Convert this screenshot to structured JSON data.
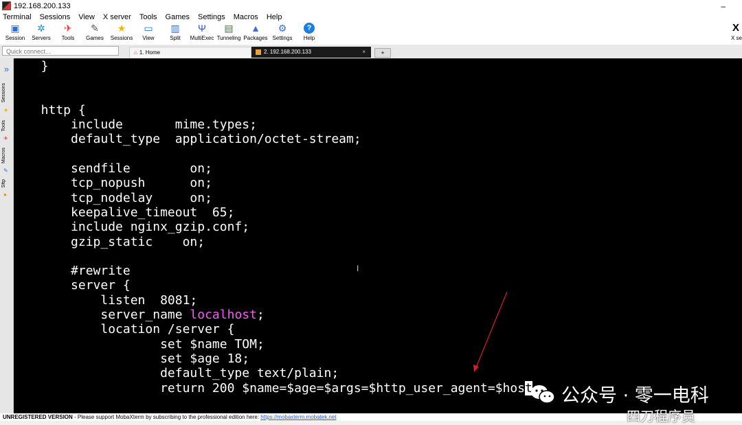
{
  "window": {
    "title": "192.168.200.133",
    "minimize_glyph": "–"
  },
  "menu": [
    "Terminal",
    "Sessions",
    "View",
    "X server",
    "Tools",
    "Games",
    "Settings",
    "Macros",
    "Help"
  ],
  "toolbar": {
    "session": "Session",
    "servers": "Servers",
    "tools": "Tools",
    "games": "Games",
    "sessions": "Sessions",
    "view": "View",
    "split": "Split",
    "multiexec": "MultiExec",
    "tunneling": "Tunneling",
    "packages": "Packages",
    "settings": "Settings",
    "help": "Help",
    "xserver": "X server"
  },
  "quick_connect": {
    "placeholder": "Quick connect..."
  },
  "tabs": {
    "home": "1. Home",
    "ssh": "2. 192.168.200.133",
    "close": "×",
    "new": "+"
  },
  "sidebar": {
    "sessions": "Sessions",
    "tools": "Tools",
    "macros": "Macros",
    "sftp": "Sftp"
  },
  "terminal": {
    "lines": [
      "  }",
      "",
      "",
      "  http {",
      "      include       mime.types;",
      "      default_type  application/octet-stream;",
      "",
      "      sendfile        on;",
      "      tcp_nopush      on;",
      "      tcp_nodelay     on;",
      "      keepalive_timeout  65;",
      "      include nginx_gzip.conf;",
      "      gzip_static    on;",
      "",
      "      #rewrite",
      "      server {",
      "          listen  8081;",
      "          server_name "
    ],
    "server_name_value": "localhost",
    "server_name_tail": ";",
    "lines_after": [
      "          location /server {",
      "                  set $name TOM;",
      "                  set $age 18;",
      "                  default_type text/plain;"
    ],
    "last_line_prefix": "                  return 200 $name=$age=$args=$http_user_agent=$hos",
    "cursor_char": "t",
    "last_line_suffix": ";"
  },
  "watermark": {
    "text": "公众号 · 零一电科",
    "bottom_text": "四刀程序员"
  },
  "status": {
    "unregistered": "UNREGISTERED VERSION",
    "message": " -  Please support MobaXterm by subscribing to the professional edition here: ",
    "link": "https://mobaxterm.mobatek.net"
  },
  "colors": {
    "terminal_bg": "#000000",
    "terminal_fg": "#ffffff",
    "highlight": "#ff55ff",
    "annotation_arrow": "#d42020"
  }
}
